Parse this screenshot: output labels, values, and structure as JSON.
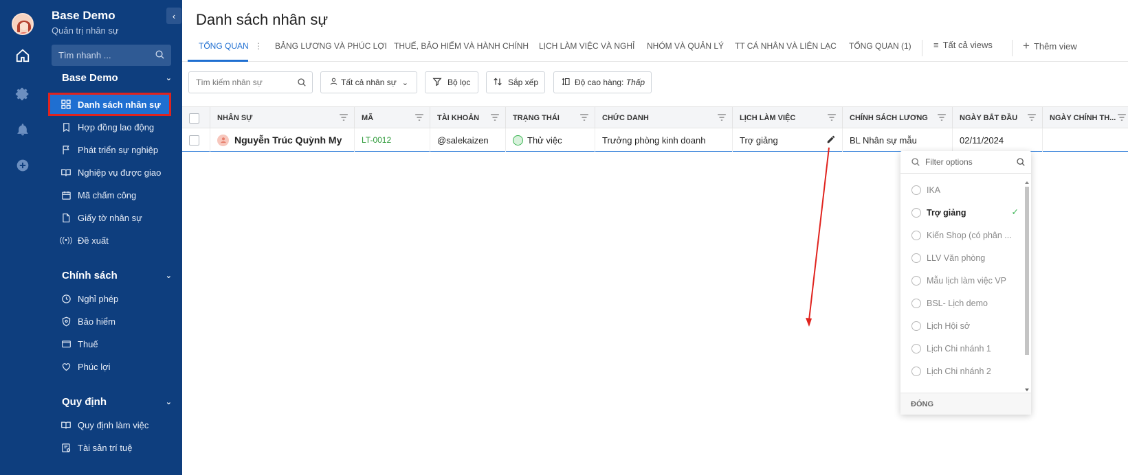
{
  "rail": {
    "icons": [
      "user-avatar",
      "home-icon",
      "settings-icon",
      "bell-icon",
      "add-circle-icon"
    ]
  },
  "sidebar": {
    "title": "Base Demo",
    "subtitle": "Quản trị nhân sự",
    "search_placeholder": "Tìm nhanh ...",
    "groups": [
      {
        "label": "Base Demo",
        "items": [
          {
            "label": "Danh sách nhân sự",
            "icon": "grid-icon",
            "active": true
          },
          {
            "label": "Hợp đồng lao động",
            "icon": "bookmark-icon"
          },
          {
            "label": "Phát triển sự nghiệp",
            "icon": "flag-icon"
          },
          {
            "label": "Nghiệp vụ được giao",
            "icon": "book-icon"
          },
          {
            "label": "Mã chấm công",
            "icon": "calendar-icon"
          },
          {
            "label": "Giấy tờ nhân sự",
            "icon": "document-icon"
          },
          {
            "label": "Đề xuất",
            "icon": "broadcast-icon"
          }
        ]
      },
      {
        "label": "Chính sách",
        "items": [
          {
            "label": "Nghỉ phép",
            "icon": "clock-icon"
          },
          {
            "label": "Bảo hiểm",
            "icon": "shield-icon"
          },
          {
            "label": "Thuế",
            "icon": "wallet-icon"
          },
          {
            "label": "Phúc lợi",
            "icon": "heart-hand-icon"
          }
        ]
      },
      {
        "label": "Quy định",
        "items": [
          {
            "label": "Quy định làm việc",
            "icon": "book-open-icon"
          },
          {
            "label": "Tài sản trí tuệ",
            "icon": "certificate-icon"
          }
        ]
      }
    ]
  },
  "main": {
    "title": "Danh sách nhân sự",
    "tabs": [
      {
        "label": "TỔNG QUAN",
        "active": true
      },
      {
        "label": "BẢNG LƯƠNG VÀ PHÚC LỢI"
      },
      {
        "label": "THUẾ, BẢO HIỂM VÀ HÀNH CHÍNH"
      },
      {
        "label": "LỊCH LÀM VIỆC VÀ NGHỈ"
      },
      {
        "label": "NHÓM VÀ QUẢN LÝ"
      },
      {
        "label": "TT CÁ NHÂN VÀ LIÊN LẠC"
      },
      {
        "label": "TỔNG QUAN (1)"
      }
    ],
    "all_views_label": "Tất cả views",
    "add_view_label": "Thêm view",
    "toolbar": {
      "search_placeholder": "Tìm kiếm nhân sự",
      "people_filter": "Tất cả nhân sự",
      "filter": "Bộ lọc",
      "sort": "Sắp xếp",
      "row_height_label": "Độ cao hàng:",
      "row_height_value": "Thấp"
    },
    "table": {
      "columns": [
        "NHÂN SỰ",
        "MÃ",
        "TÀI KHOẢN",
        "TRẠNG THÁI",
        "CHỨC DANH",
        "LỊCH LÀM VIỆC",
        "CHÍNH SÁCH LƯƠNG",
        "NGÀY BẮT ĐẦU",
        "NGÀY CHÍNH TH..."
      ],
      "rows": [
        {
          "name": "Nguyễn Trúc Quỳnh My",
          "code": "LT-0012",
          "account": "@salekaizen",
          "status": "Thử việc",
          "title": "Trưởng phòng kinh doanh",
          "schedule": "Trợ giảng",
          "salary_policy": "BL Nhân sự mẫu",
          "start_date": "02/11/2024",
          "official_date": ""
        }
      ]
    },
    "dropdown": {
      "filter_placeholder": "Filter options",
      "options": [
        {
          "label": "IKA"
        },
        {
          "label": "Trợ giảng",
          "selected": true
        },
        {
          "label": "Kiến Shop (có phân ..."
        },
        {
          "label": "LLV Văn phòng"
        },
        {
          "label": "Mẫu lịch làm việc VP"
        },
        {
          "label": "BSL- Lịch demo"
        },
        {
          "label": "Lịch Hội sở"
        },
        {
          "label": "Lịch Chi nhánh 1"
        },
        {
          "label": "Lịch Chi nhánh 2"
        }
      ],
      "close_label": "ĐÓNG"
    }
  },
  "colors": {
    "sidebar_bg": "#0e3e7e",
    "active_item": "#1f6fd1",
    "highlight_border": "#e0231e",
    "code_green": "#2e9b3a",
    "annotation_arrow": "#e0231e"
  }
}
